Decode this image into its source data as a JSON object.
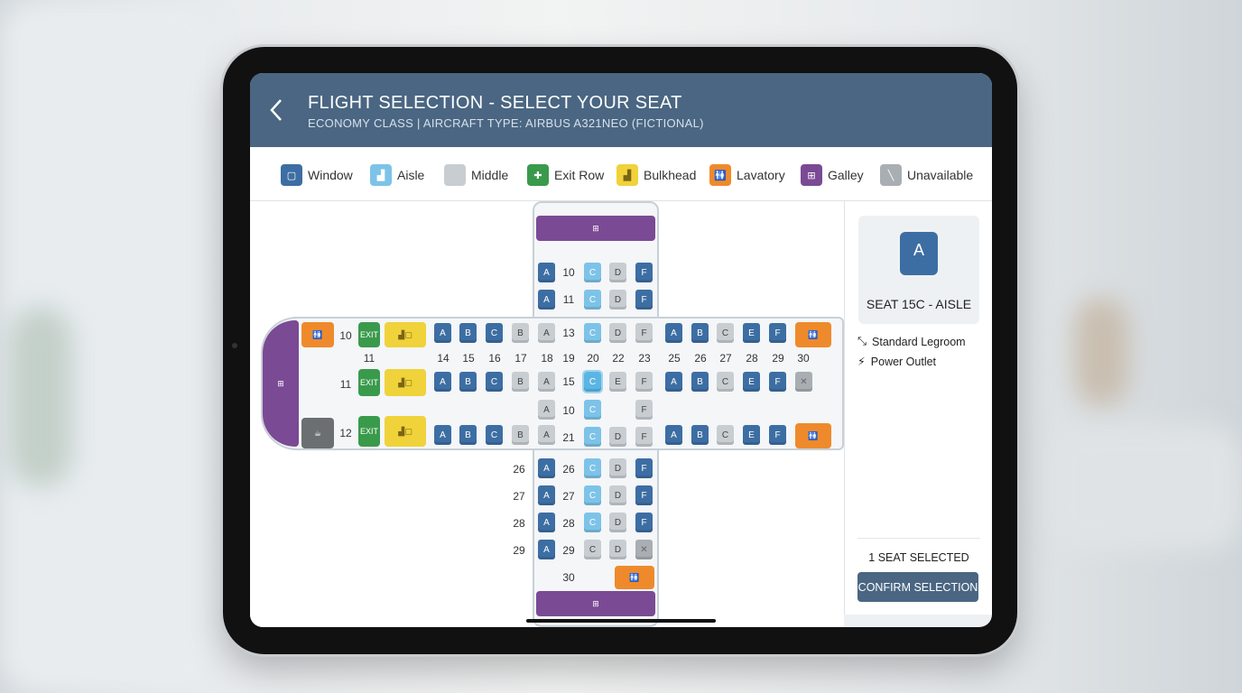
{
  "header": {
    "back_icon": "chevron-left-icon",
    "title": "FLIGHT SELECTION - SELECT YOUR SEAT",
    "subtitle": "ECONOMY CLASS  |  AIRCRAFT TYPE: AIRBUS A321NEO (FICTIONAL)"
  },
  "legend": [
    {
      "label": "Window",
      "color": "#3d6ea3",
      "icon": "seat-window-icon"
    },
    {
      "label": "Aisle",
      "color": "#7dc3e8",
      "icon": "seat-aisle-icon"
    },
    {
      "label": "Middle",
      "color": "#c8cdd2",
      "icon": "seat-middle-icon"
    },
    {
      "label": "Exit Row",
      "color": "#3a9a4c",
      "icon": "exit-icon"
    },
    {
      "label": "Bulkhead",
      "color": "#f0d23a",
      "icon": "bulkhead-icon"
    },
    {
      "label": "Lavatory",
      "color": "#ef8a2c",
      "icon": "lavatory-icon"
    },
    {
      "label": "Galley",
      "color": "#7b4a94",
      "icon": "galley-icon"
    },
    {
      "label": "Unavailable",
      "color": "#a9aeb3",
      "icon": "unavailable-icon"
    }
  ],
  "map": {
    "exit_label": "EXIT",
    "vertical_rows_top": [
      {
        "row": "10",
        "seats": [
          "A",
          "C",
          "D",
          "F"
        ]
      },
      {
        "row": "11",
        "seats": [
          "A",
          "C",
          "D",
          "F"
        ]
      }
    ],
    "horizontal_rows": [
      {
        "label": "10",
        "left": [
          "A",
          "B",
          "C",
          "B",
          "A"
        ],
        "mid": "13",
        "right_mid": [
          "C",
          "D",
          "F"
        ],
        "right": [
          "A",
          "B",
          "C",
          "E",
          "F"
        ]
      },
      {
        "label": "11",
        "left": [
          "A",
          "B",
          "C",
          "B",
          "A"
        ],
        "mid": "15",
        "right_mid": [
          "C",
          "E",
          "F"
        ],
        "right": [
          "A",
          "B",
          "C",
          "E",
          "F"
        ]
      },
      {
        "label": "12",
        "left": [
          "A",
          "B",
          "C",
          "B",
          "A"
        ],
        "mid": "21",
        "right_mid": [
          "C",
          "D",
          "F"
        ],
        "right": [
          "A",
          "B",
          "C",
          "E",
          "F"
        ]
      }
    ],
    "column_numbers": [
      "11",
      "14",
      "15",
      "16",
      "17",
      "18",
      "19",
      "20",
      "22",
      "23",
      "25",
      "26",
      "27",
      "28",
      "29",
      "30"
    ],
    "mid_row_between": {
      "row": "10",
      "seats": [
        "A",
        "C",
        "F"
      ]
    },
    "vertical_rows_bottom": [
      {
        "row_left": "26",
        "row": "26",
        "seats": [
          "A",
          "C",
          "D",
          "F"
        ]
      },
      {
        "row_left": "27",
        "row": "27",
        "seats": [
          "A",
          "C",
          "D",
          "F"
        ]
      },
      {
        "row_left": "28",
        "row": "28",
        "seats": [
          "A",
          "C",
          "D",
          "F"
        ]
      },
      {
        "row_left": "29",
        "row": "29",
        "seats": [
          "A",
          "C",
          "D"
        ]
      },
      {
        "row_left": "",
        "row": "30",
        "seats": []
      }
    ]
  },
  "panel": {
    "seat_letter": "A",
    "seat_label": "SEAT 15C - AISLE",
    "features": [
      "Standard Legroom",
      "Power Outlet"
    ],
    "count": "1 SEAT SELECTED",
    "confirm": "CONFIRM SELECTION"
  }
}
